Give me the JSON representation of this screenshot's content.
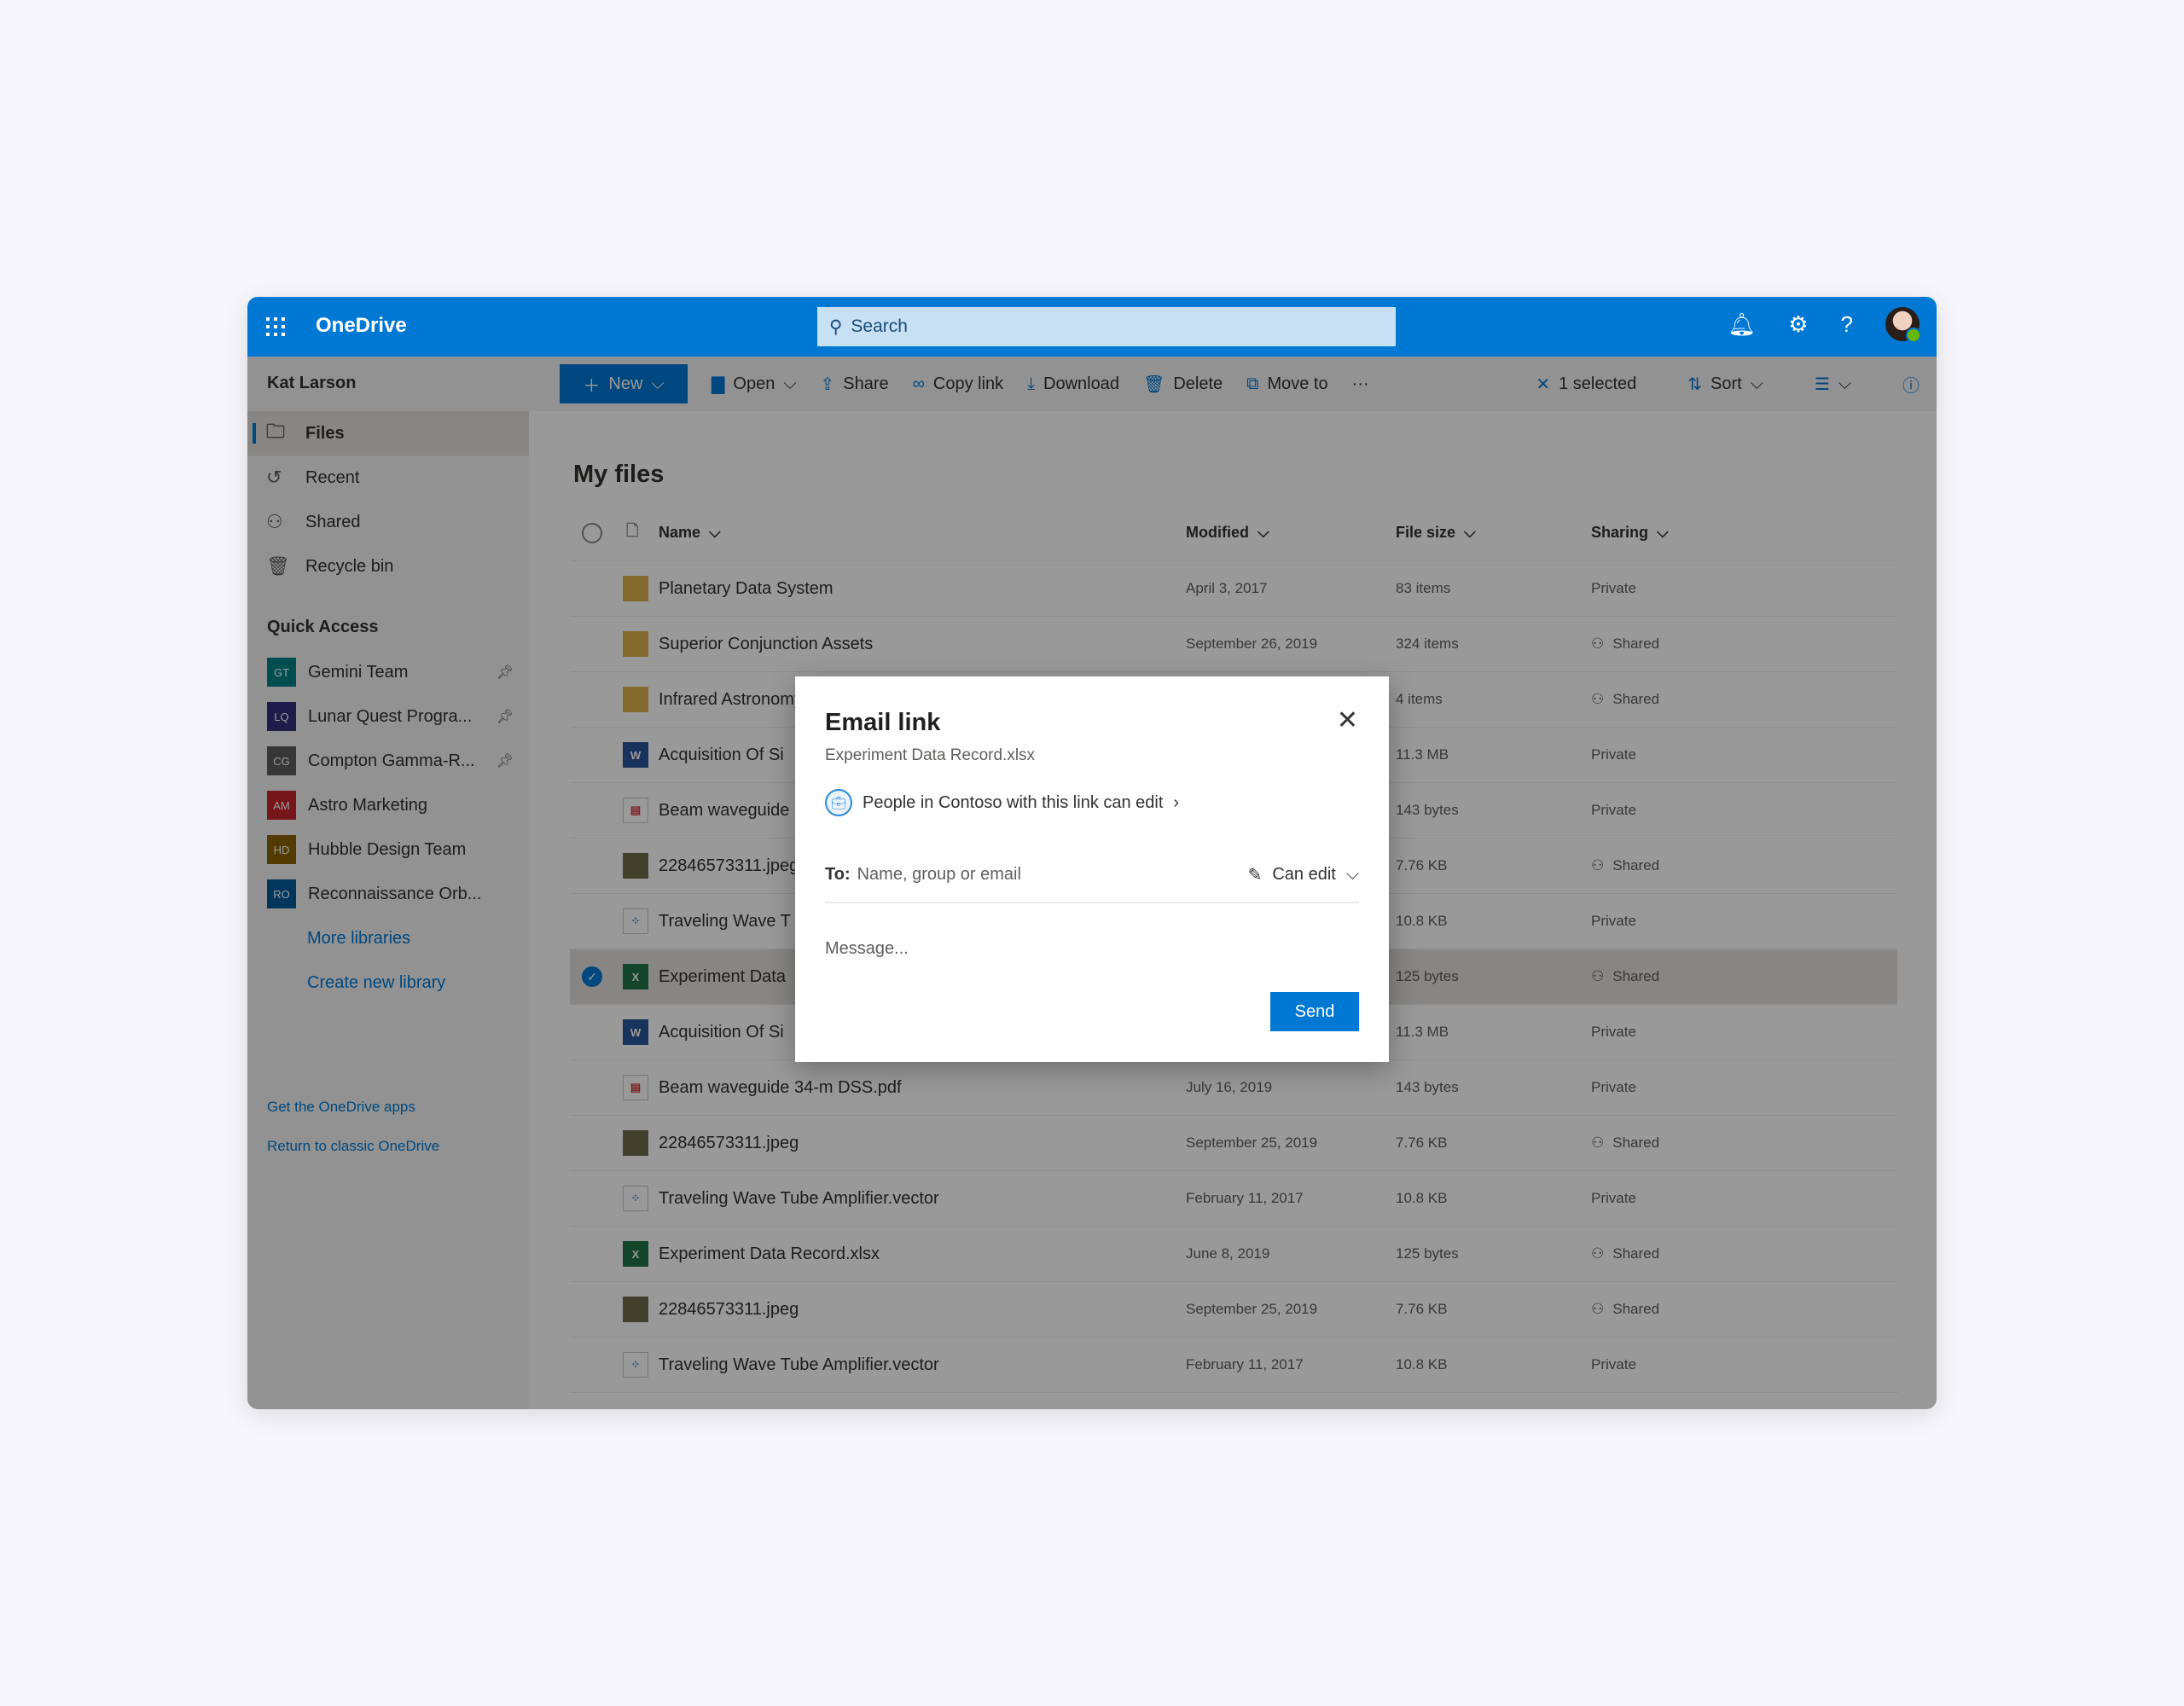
{
  "header": {
    "app": "OneDrive",
    "search_placeholder": "Search",
    "icons": [
      "bell-icon",
      "gear-icon",
      "help-icon",
      "avatar"
    ]
  },
  "sidebar": {
    "user": "Kat Larson",
    "nav": [
      {
        "label": "Files",
        "icon": "folder-icon"
      },
      {
        "label": "Recent",
        "icon": "clock-icon"
      },
      {
        "label": "Shared",
        "icon": "people-icon"
      },
      {
        "label": "Recycle bin",
        "icon": "trash-icon"
      }
    ],
    "quick_access": "Quick Access",
    "libraries": [
      {
        "initials": "GT",
        "label": "Gemini Team",
        "color": "#038387",
        "pinned": true
      },
      {
        "initials": "LQ",
        "label": "Lunar Quest Progra...",
        "color": "#32317a",
        "pinned": true
      },
      {
        "initials": "CG",
        "label": "Compton Gamma-R...",
        "color": "#5c5c5c",
        "pinned": true
      },
      {
        "initials": "AM",
        "label": "Astro Marketing",
        "color": "#c4262e",
        "pinned": false
      },
      {
        "initials": "HD",
        "label": "Hubble Design Team",
        "color": "#8a6100",
        "pinned": false
      },
      {
        "initials": "RO",
        "label": "Reconnaissance Orb...",
        "color": "#005b9a",
        "pinned": false
      }
    ],
    "more_libraries": "More libraries",
    "create_library": "Create new library",
    "get_apps": "Get the OneDrive apps",
    "classic": "Return to classic OneDrive"
  },
  "toolbar": {
    "new": "New",
    "open": "Open",
    "share": "Share",
    "copy_link": "Copy link",
    "download": "Download",
    "delete": "Delete",
    "move_to": "Move to",
    "more": "···",
    "selected": "1 selected",
    "sort": "Sort"
  },
  "main": {
    "title": "My files",
    "columns": {
      "name": "Name",
      "modified": "Modified",
      "size": "File size",
      "sharing": "Sharing"
    },
    "rows": [
      {
        "type": "folder",
        "name": "Planetary Data System",
        "modified": "April 3, 2017",
        "size": "83 items",
        "sharing": "Private"
      },
      {
        "type": "folder",
        "name": "Superior Conjunction Assets",
        "modified": "September 26, 2019",
        "size": "324 items",
        "sharing": "Shared"
      },
      {
        "type": "folder",
        "name": "Infrared Astronomy",
        "modified": "",
        "size": "4 items",
        "sharing": "Shared"
      },
      {
        "type": "word",
        "name": "Acquisition Of Si",
        "modified": "",
        "size": "11.3 MB",
        "sharing": "Private"
      },
      {
        "type": "pdf",
        "name": "Beam waveguide",
        "modified": "",
        "size": "143 bytes",
        "sharing": "Private"
      },
      {
        "type": "image",
        "name": "22846573311.jpeg",
        "modified": "",
        "size": "7.76 KB",
        "sharing": "Shared"
      },
      {
        "type": "vector",
        "name": "Traveling Wave T",
        "modified": "",
        "size": "10.8 KB",
        "sharing": "Private"
      },
      {
        "type": "excel",
        "name": "Experiment Data",
        "modified": "",
        "size": "125 bytes",
        "sharing": "Shared",
        "selected": true
      },
      {
        "type": "word",
        "name": "Acquisition Of Si",
        "modified": "",
        "size": "11.3 MB",
        "sharing": "Private"
      },
      {
        "type": "pdf",
        "name": "Beam waveguide 34-m DSS.pdf",
        "modified": "July 16, 2019",
        "size": "143 bytes",
        "sharing": "Private"
      },
      {
        "type": "image",
        "name": "22846573311.jpeg",
        "modified": "September 25, 2019",
        "size": "7.76 KB",
        "sharing": "Shared"
      },
      {
        "type": "vector",
        "name": "Traveling Wave Tube Amplifier.vector",
        "modified": "February 11, 2017",
        "size": "10.8 KB",
        "sharing": "Private"
      },
      {
        "type": "excel",
        "name": "Experiment Data Record.xlsx",
        "modified": "June 8, 2019",
        "size": "125 bytes",
        "sharing": "Shared"
      },
      {
        "type": "image",
        "name": "22846573311.jpeg",
        "modified": "September 25, 2019",
        "size": "7.76 KB",
        "sharing": "Shared"
      },
      {
        "type": "vector",
        "name": "Traveling Wave Tube Amplifier.vector",
        "modified": "February 11, 2017",
        "size": "10.8 KB",
        "sharing": "Private"
      }
    ]
  },
  "dialog": {
    "title": "Email link",
    "file": "Experiment Data Record.xlsx",
    "permission": "People in Contoso with this link can edit",
    "to_label": "To:",
    "to_placeholder": "Name, group or email",
    "access": "Can edit",
    "message_placeholder": "Message...",
    "send": "Send"
  },
  "colors": {
    "brand": "#0078d4",
    "search_bg": "#c7e0f4"
  }
}
